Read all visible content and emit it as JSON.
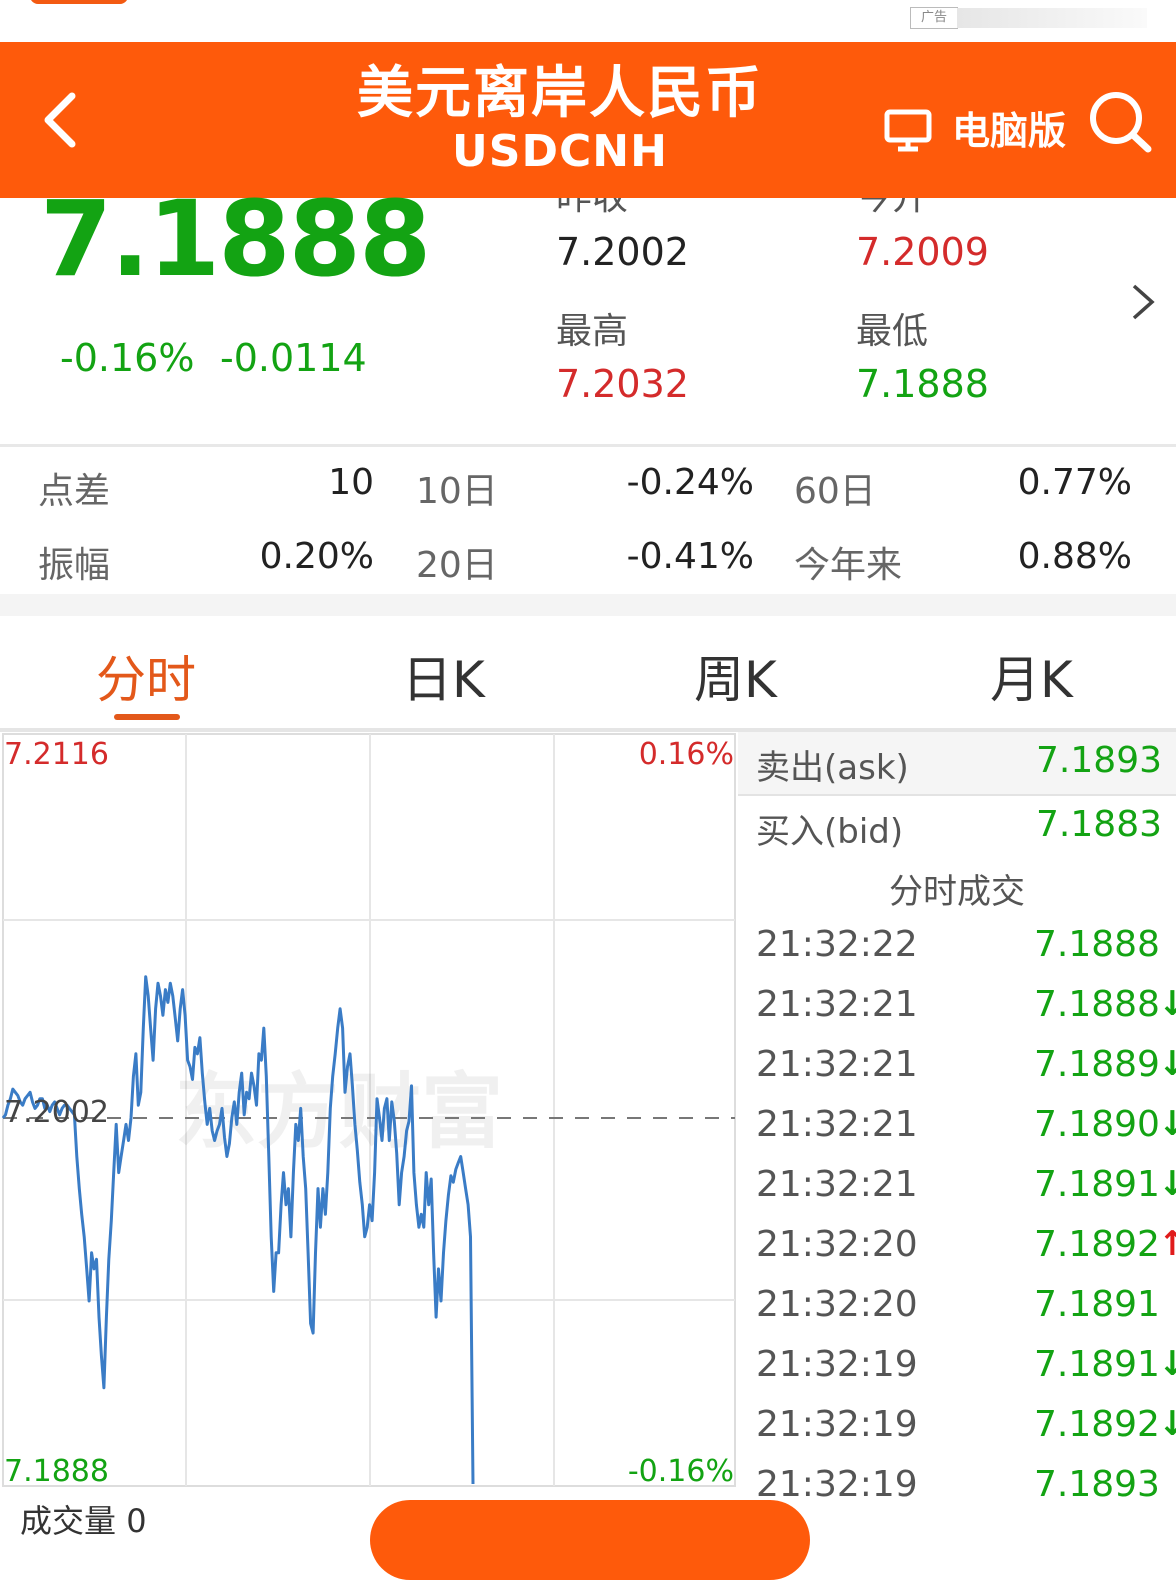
{
  "ad": {
    "tag": "广告"
  },
  "header": {
    "title": "美元离岸人民币",
    "code": "USDCNH",
    "pc_label": "电脑版"
  },
  "quote": {
    "price": "7.1888",
    "change_pct": "-0.16%",
    "change": "-0.0114",
    "prev_close_label": "昨收",
    "prev_close": "7.2002",
    "open_label": "今开",
    "open": "7.2009",
    "high_label": "最高",
    "high": "7.2032",
    "low_label": "最低",
    "low": "7.1888"
  },
  "stats": {
    "spread_label": "点差",
    "spread": "10",
    "d10_label": "10日",
    "d10": "-0.24%",
    "d60_label": "60日",
    "d60": "0.77%",
    "amplitude_label": "振幅",
    "amplitude": "0.20%",
    "d20_label": "20日",
    "d20": "-0.41%",
    "ytd_label": "今年来",
    "ytd": "0.88%"
  },
  "tabs": [
    "分时",
    "日K",
    "周K",
    "月K"
  ],
  "chart_data": {
    "type": "line",
    "y_max_label": "7.2116",
    "y_min_label": "7.1888",
    "y_mid_label": "7.2002",
    "pct_max_label": "0.16%",
    "pct_min_label": "-0.16%",
    "ylim": [
      7.1888,
      7.2116
    ],
    "baseline": 7.2002,
    "watermark": "东方财富",
    "series": [
      {
        "values": [
          7.2002,
          7.2003,
          7.2006,
          7.2008,
          7.2011,
          7.201,
          7.2009,
          7.2007,
          7.2006,
          7.2008,
          7.2009,
          7.201,
          7.2007,
          7.2005,
          7.2006,
          7.2008,
          7.2008,
          7.2005,
          7.2006,
          7.2004,
          7.2006,
          7.2007,
          7.2005,
          7.2003,
          7.2005,
          7.2006,
          7.2006,
          7.2005,
          7.2004,
          7.2003,
          7.199,
          7.198,
          7.1972,
          7.1965,
          7.1955,
          7.1945,
          7.196,
          7.1955,
          7.1958,
          7.194,
          7.1928,
          7.1918,
          7.194,
          7.1958,
          7.197,
          7.1985,
          7.2,
          7.1985,
          7.199,
          7.1995,
          7.2,
          7.1995,
          7.2002,
          7.2015,
          7.2022,
          7.2006,
          7.201,
          7.203,
          7.2046,
          7.204,
          7.203,
          7.202,
          7.2036,
          7.2044,
          7.204,
          7.2034,
          7.2042,
          7.2038,
          7.2044,
          7.204,
          7.2033,
          7.2026,
          7.2036,
          7.2042,
          7.2034,
          7.202,
          7.2018,
          7.2014,
          7.2024,
          7.2022,
          7.2027,
          7.2016,
          7.2007,
          7.2,
          7.2005,
          7.1998,
          7.1995,
          7.1998,
          7.2,
          7.2005,
          7.1996,
          7.199,
          7.1994,
          7.2002,
          7.2007,
          7.2,
          7.201,
          7.2016,
          7.2003,
          7.201,
          7.2008,
          7.2016,
          7.2012,
          7.2006,
          7.2022,
          7.202,
          7.203,
          7.2015,
          7.199,
          7.1965,
          7.1948,
          7.196,
          7.196,
          7.1975,
          7.1985,
          7.1975,
          7.198,
          7.1965,
          7.1985,
          7.2,
          7.1995,
          7.2005,
          7.199,
          7.198,
          7.196,
          7.1938,
          7.1935,
          7.196,
          7.198,
          7.1968,
          7.198,
          7.1972,
          7.1985,
          7.2005,
          7.2015,
          7.2022,
          7.203,
          7.2036,
          7.203,
          7.201,
          7.2018,
          7.2022,
          7.2012,
          7.2,
          7.1992,
          7.1982,
          7.1975,
          7.1965,
          7.1968,
          7.1975,
          7.197,
          7.1985,
          7.2008,
          7.2002,
          7.1995,
          7.2005,
          7.2008,
          7.1995,
          7.2007,
          7.2001,
          7.1991,
          7.1975,
          7.1985,
          7.199,
          7.1998,
          7.2001,
          7.2012,
          7.1985,
          7.1975,
          7.1968,
          7.1972,
          7.1968,
          7.1985,
          7.1975,
          7.1983,
          7.196,
          7.194,
          7.1955,
          7.1945,
          7.196,
          7.197,
          7.1978,
          7.1984,
          7.1982,
          7.1986,
          7.1988,
          7.199,
          7.1985,
          7.198,
          7.1975,
          7.1965,
          7.1888
        ]
      }
    ]
  },
  "side": {
    "ask_label": "卖出(ask)",
    "ask": "7.1893",
    "bid_label": "买入(bid)",
    "bid": "7.1883",
    "trades_title": "分时成交",
    "trades": [
      {
        "time": "21:32:22",
        "price": "7.1888",
        "arrow": "",
        "color": "#13a313"
      },
      {
        "time": "21:32:21",
        "price": "7.1888",
        "arrow": "↓",
        "color": "#13a313"
      },
      {
        "time": "21:32:21",
        "price": "7.1889",
        "arrow": "↓",
        "color": "#13a313"
      },
      {
        "time": "21:32:21",
        "price": "7.1890",
        "arrow": "↓",
        "color": "#13a313"
      },
      {
        "time": "21:32:21",
        "price": "7.1891",
        "arrow": "↓",
        "color": "#13a313"
      },
      {
        "time": "21:32:20",
        "price": "7.1892",
        "arrow": "↑",
        "color": "#13a313",
        "arrow_color": "#e01b1b"
      },
      {
        "time": "21:32:20",
        "price": "7.1891",
        "arrow": "",
        "color": "#13a313"
      },
      {
        "time": "21:32:19",
        "price": "7.1891",
        "arrow": "↓",
        "color": "#13a313"
      },
      {
        "time": "21:32:19",
        "price": "7.1892",
        "arrow": "↓",
        "color": "#13a313"
      },
      {
        "time": "21:32:19",
        "price": "7.1893",
        "arrow": "",
        "color": "#13a313"
      }
    ]
  },
  "bottom": {
    "volume_label": "成交量",
    "volume": "0"
  }
}
